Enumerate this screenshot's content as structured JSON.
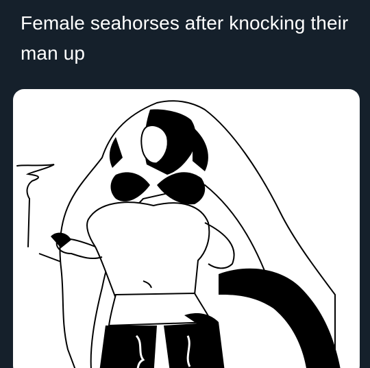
{
  "tweet": {
    "text": "Female seahorses after knocking their man up"
  },
  "media": {
    "alt": "",
    "icon": "drawing-image"
  },
  "colors": {
    "background": "#15202b",
    "text": "#ffffff",
    "card": "#ffffff",
    "ink": "#000000"
  }
}
